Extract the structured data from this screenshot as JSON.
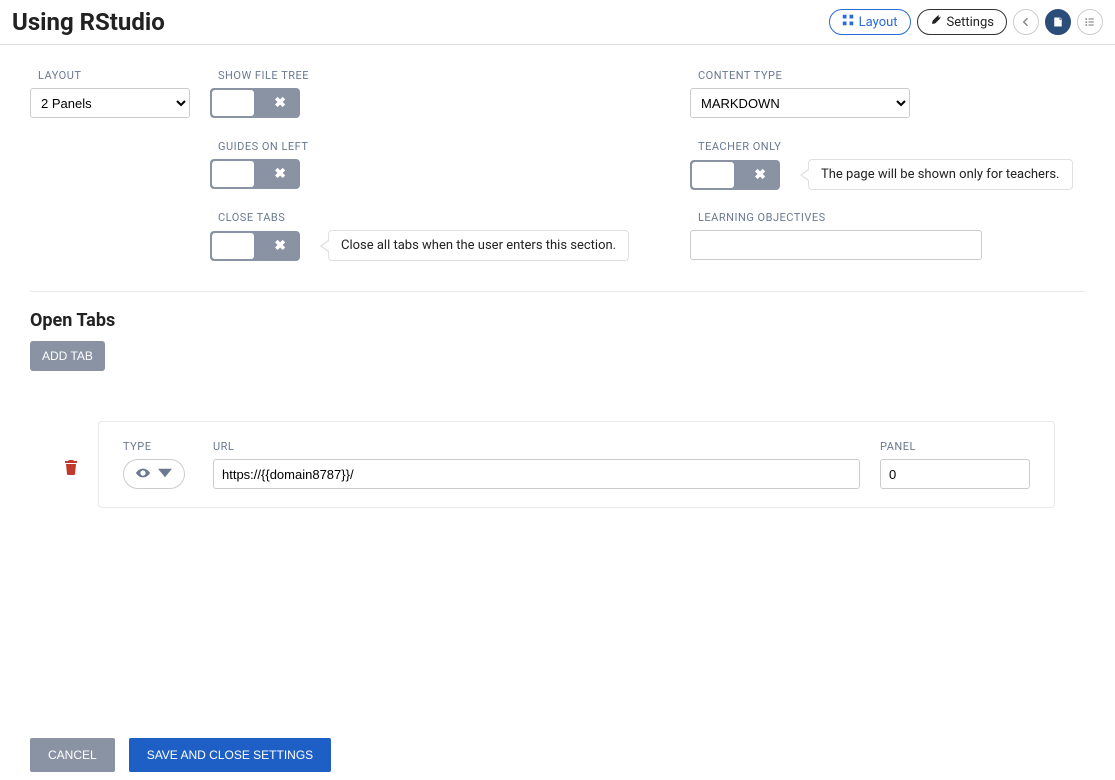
{
  "header": {
    "title": "Using RStudio",
    "layout_btn": "Layout",
    "settings_btn": "Settings"
  },
  "form": {
    "layout": {
      "label": "LAYOUT",
      "value": "2 Panels"
    },
    "show_file_tree": {
      "label": "SHOW FILE TREE"
    },
    "guides_on_left": {
      "label": "GUIDES ON LEFT"
    },
    "close_tabs": {
      "label": "CLOSE TABS",
      "tooltip": "Close all tabs when the user enters this section."
    },
    "content_type": {
      "label": "CONTENT TYPE",
      "value": "MARKDOWN"
    },
    "teacher_only": {
      "label": "TEACHER ONLY",
      "tooltip": "The page will be shown only for teachers."
    },
    "learning_objectives": {
      "label": "LEARNING OBJECTIVES",
      "value": ""
    }
  },
  "open_tabs": {
    "title": "Open Tabs",
    "add_btn": "ADD TAB",
    "rows": [
      {
        "type_label": "TYPE",
        "url_label": "URL",
        "panel_label": "PANEL",
        "url": "https://{{domain8787}}/",
        "panel": "0"
      }
    ]
  },
  "footer": {
    "cancel": "CANCEL",
    "save": "SAVE AND CLOSE SETTINGS"
  }
}
